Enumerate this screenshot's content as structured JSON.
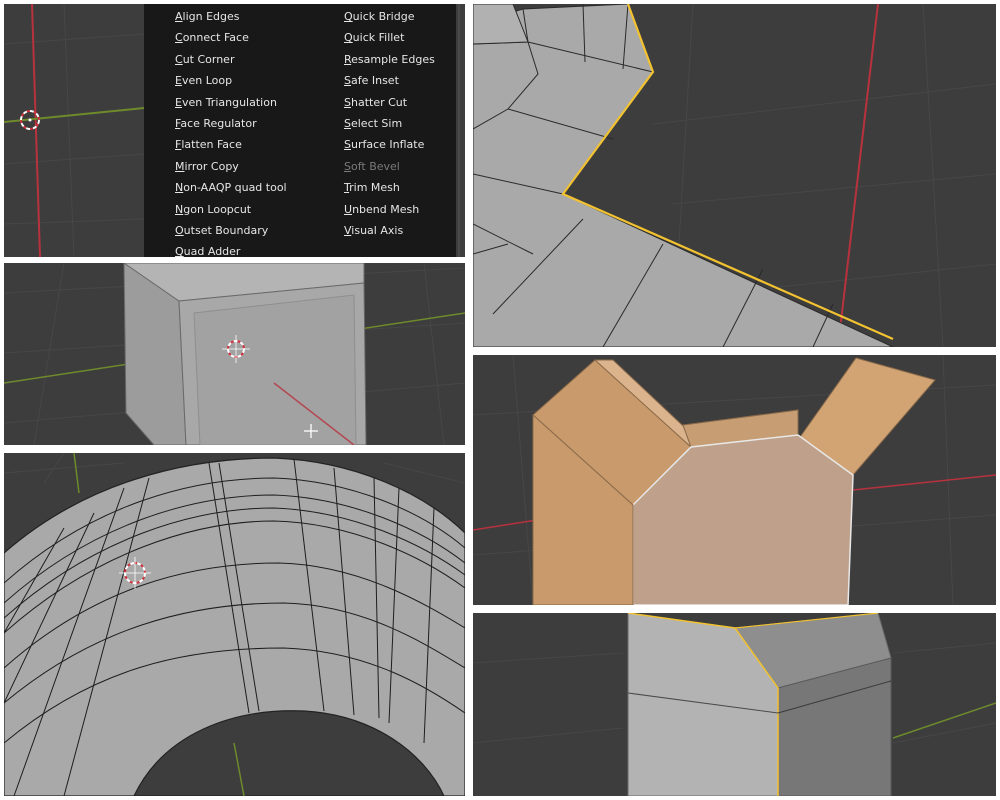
{
  "menu": {
    "left_column": [
      {
        "label": "Align Edges",
        "enabled": true
      },
      {
        "label": "Connect Face",
        "enabled": true
      },
      {
        "label": "Cut Corner",
        "enabled": true
      },
      {
        "label": "Even Loop",
        "enabled": true
      },
      {
        "label": "Even Triangulation",
        "enabled": true
      },
      {
        "label": "Face Regulator",
        "enabled": true
      },
      {
        "label": "Flatten Face",
        "enabled": true
      },
      {
        "label": "Mirror Copy",
        "enabled": true
      },
      {
        "label": "Non-AAQP quad tool",
        "enabled": true
      },
      {
        "label": "Ngon Loopcut",
        "enabled": true
      },
      {
        "label": "Outset Boundary",
        "enabled": true
      },
      {
        "label": "Quad Adder",
        "enabled": true
      }
    ],
    "right_column": [
      {
        "label": "Quick Bridge",
        "enabled": true
      },
      {
        "label": "Quick Fillet",
        "enabled": true
      },
      {
        "label": "Resample Edges",
        "enabled": true
      },
      {
        "label": "Safe Inset",
        "enabled": true
      },
      {
        "label": "Shatter Cut",
        "enabled": true
      },
      {
        "label": "Select Sim",
        "enabled": true
      },
      {
        "label": "Surface Inflate",
        "enabled": true
      },
      {
        "label": "Soft Bevel",
        "enabled": false
      },
      {
        "label": "Trim Mesh",
        "enabled": true
      },
      {
        "label": "Unbend Mesh",
        "enabled": true
      },
      {
        "label": "Visual Axis",
        "enabled": true
      }
    ]
  },
  "colors": {
    "viewport_bg": "#3d3d3d",
    "menu_bg": "#181818",
    "mesh_gray": "#a9a9a9",
    "mesh_orange": "#c99a6b",
    "selection_yellow": "#f2c230",
    "x_axis_red": "#b8323e",
    "y_axis_green": "#6e8a2c"
  },
  "icons": [
    "3d-cursor-icon",
    "crosshair-cursor-icon"
  ]
}
